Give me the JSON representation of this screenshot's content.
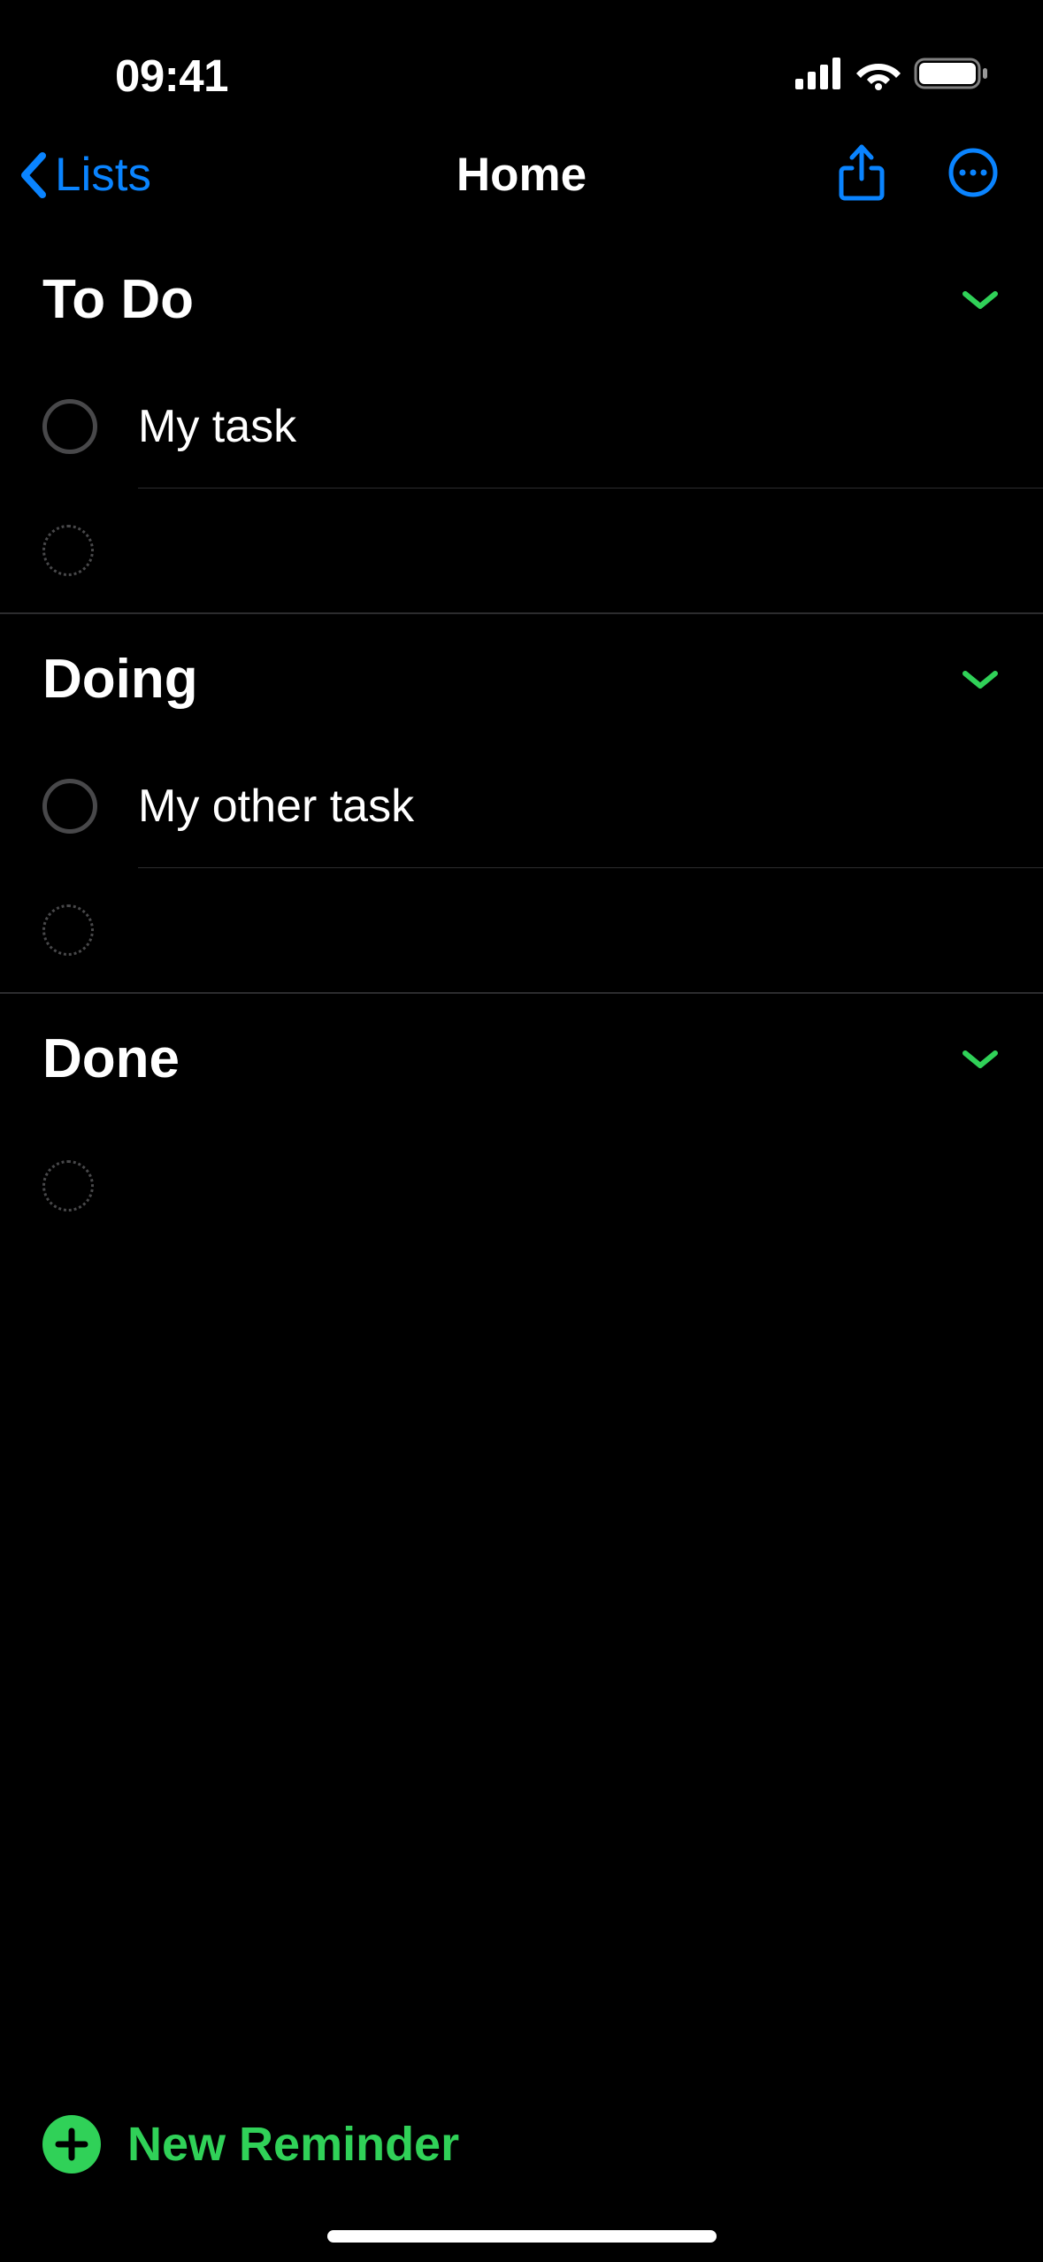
{
  "statusBar": {
    "time": "09:41"
  },
  "nav": {
    "backLabel": "Lists",
    "title": "Home"
  },
  "sections": [
    {
      "title": "To Do",
      "items": [
        {
          "label": "My task"
        }
      ]
    },
    {
      "title": "Doing",
      "items": [
        {
          "label": "My other task"
        }
      ]
    },
    {
      "title": "Done",
      "items": []
    }
  ],
  "footer": {
    "newReminderLabel": "New Reminder"
  },
  "colors": {
    "accentBlue": "#0a84ff",
    "accentGreen": "#30d158",
    "divider": "#2c2c2e",
    "circleBorder": "#48484a"
  }
}
